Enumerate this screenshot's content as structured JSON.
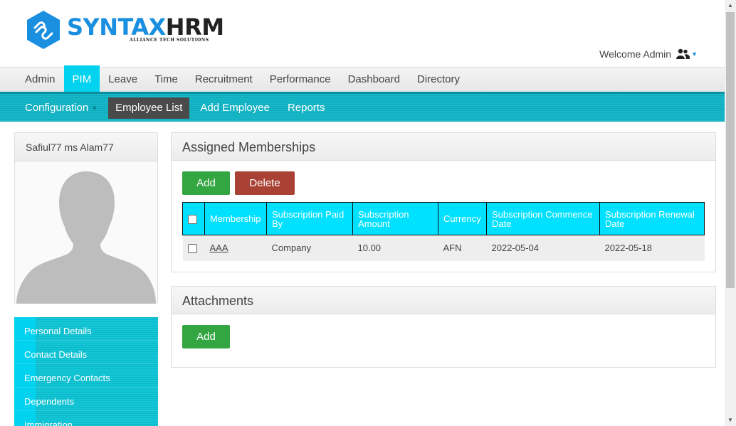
{
  "brand": {
    "name_part1": "SYNTAX",
    "name_part2": "HRM",
    "tagline": "ALLIANCE TECH SOLUTIONS"
  },
  "user": {
    "welcome": "Welcome Admin"
  },
  "main_menu": [
    {
      "label": "Admin"
    },
    {
      "label": "PIM",
      "active": true
    },
    {
      "label": "Leave"
    },
    {
      "label": "Time"
    },
    {
      "label": "Recruitment"
    },
    {
      "label": "Performance"
    },
    {
      "label": "Dashboard"
    },
    {
      "label": "Directory"
    }
  ],
  "sub_menu": [
    {
      "label": "Configuration"
    },
    {
      "label": "Employee List",
      "active": true
    },
    {
      "label": "Add Employee"
    },
    {
      "label": "Reports"
    }
  ],
  "profile": {
    "name": "Safiul77 ms Alam77"
  },
  "side_nav": [
    {
      "label": "Personal Details"
    },
    {
      "label": "Contact Details"
    },
    {
      "label": "Emergency Contacts"
    },
    {
      "label": "Dependents"
    },
    {
      "label": "Immigration"
    }
  ],
  "memberships": {
    "title": "Assigned Memberships",
    "add_label": "Add",
    "delete_label": "Delete",
    "columns": [
      "Membership",
      "Subscription Paid By",
      "Subscription Amount",
      "Currency",
      "Subscription Commence Date",
      "Subscription Renewal Date"
    ],
    "rows": [
      {
        "membership": "AAA",
        "paid_by": "Company",
        "amount": "10.00",
        "currency": "AFN",
        "commence": "2022-05-04",
        "renewal": "2022-05-18"
      }
    ]
  },
  "attachments": {
    "title": "Attachments",
    "add_label": "Add"
  },
  "colors": {
    "accent": "#00d2f0",
    "add_green": "#33a642",
    "delete_red": "#a94234"
  }
}
